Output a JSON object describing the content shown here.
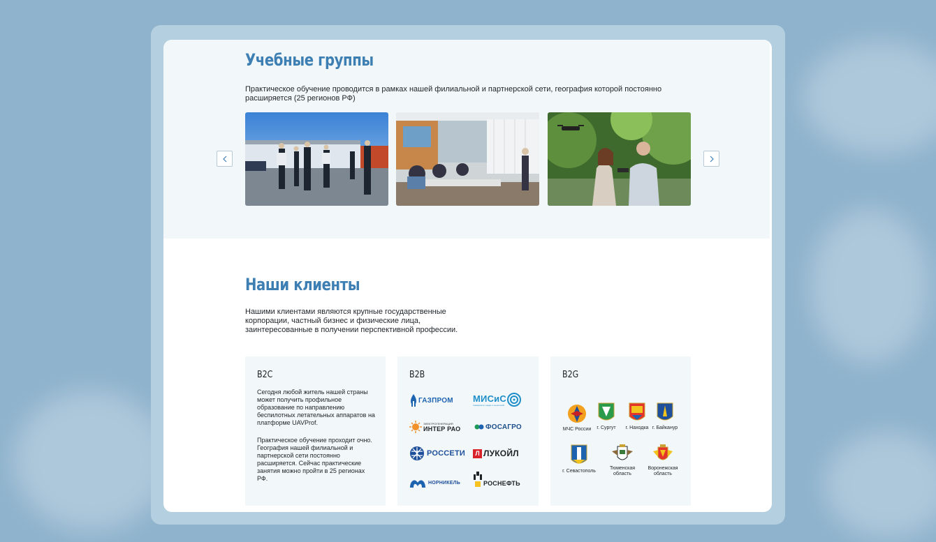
{
  "groups": {
    "title": "Учебные группы",
    "lead": "Практическое обучение проводится в рамках нашей филиальной и партнерской сети, география которой постоянно расширяется (25 регионов РФ)"
  },
  "clients": {
    "title": "Наши клиенты",
    "lead": "Нашими клиентами являются крупные государственные корпорации, частный бизнес и физические лица, заинтересованные в получении перспективной профессии.",
    "b2c": {
      "title": "B2C",
      "p1": "Сегодня любой житель нашей страны может получить профильное образование по направлению беспилотных летательных аппаратов на платформе UAVProf.",
      "p2": "Практическое обучение проходит очно. География нашей филиальной и партнерской сети постоянно расширяется. Сейчас практические занятия можно пройти в 25 регионах РФ."
    },
    "b2b": {
      "title": "B2B",
      "logos": {
        "gazprom": "ГАЗПРОМ",
        "misis": "МИСиС",
        "misis_sub": "Университет науки и технологий",
        "interrao_top": "ЭЛЕКТРОГЕНЕРАЦИЯ",
        "interrao": "ИНТЕР РАО",
        "fosagro": "ФОСАГРО",
        "rosseti": "РОССЕТИ",
        "lukoil": "ЛУКОЙЛ",
        "nornickel": "НОРНИКЕЛЬ",
        "rosneft": "РОСНЕФТЬ"
      }
    },
    "b2g": {
      "title": "B2G",
      "emblems": {
        "mchs": "МЧС России",
        "surgut": "г. Сургут",
        "nakhodka": "г. Находка",
        "baikonur": "г. Байканур",
        "sevastopol": "г. Севастополь",
        "tyumen": "Тюменская область",
        "voronezh": "Воронежская область"
      }
    }
  }
}
